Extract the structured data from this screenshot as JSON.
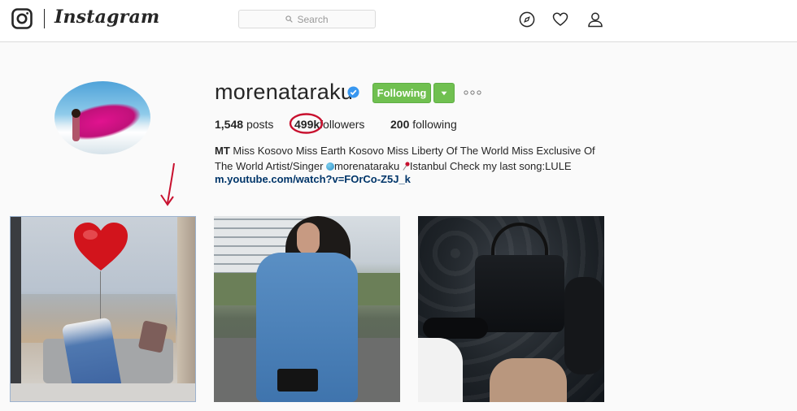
{
  "app": {
    "wordmark": "Instagram",
    "search_placeholder": "Search",
    "nav_icons": [
      "compass-icon",
      "heart-icon",
      "user-icon"
    ]
  },
  "profile": {
    "username": "morenataraku",
    "verified": true,
    "follow_button_label": "Following",
    "stats": {
      "posts_count": "1,548",
      "posts_label": "posts",
      "followers_count": "499k",
      "followers_label": "followers",
      "following_count": "200",
      "following_label": "following"
    },
    "bio": {
      "name": "MT",
      "text_1": "Miss Kosovo Miss Earth Kosovo Miss Liberty Of The World Miss Exclusive Of The World Artist/Singer",
      "handle_mention": "morenataraku",
      "text_2": "Istanbul Check my last song:LULE",
      "link": "m.youtube.com/watch?v=FOrCo-Z5J_k"
    }
  },
  "posts_visible": 3,
  "colors": {
    "follow_green": "#70c050",
    "link_blue": "#003569",
    "annotation_red": "#c8102e",
    "verified_blue": "#3897f0"
  }
}
